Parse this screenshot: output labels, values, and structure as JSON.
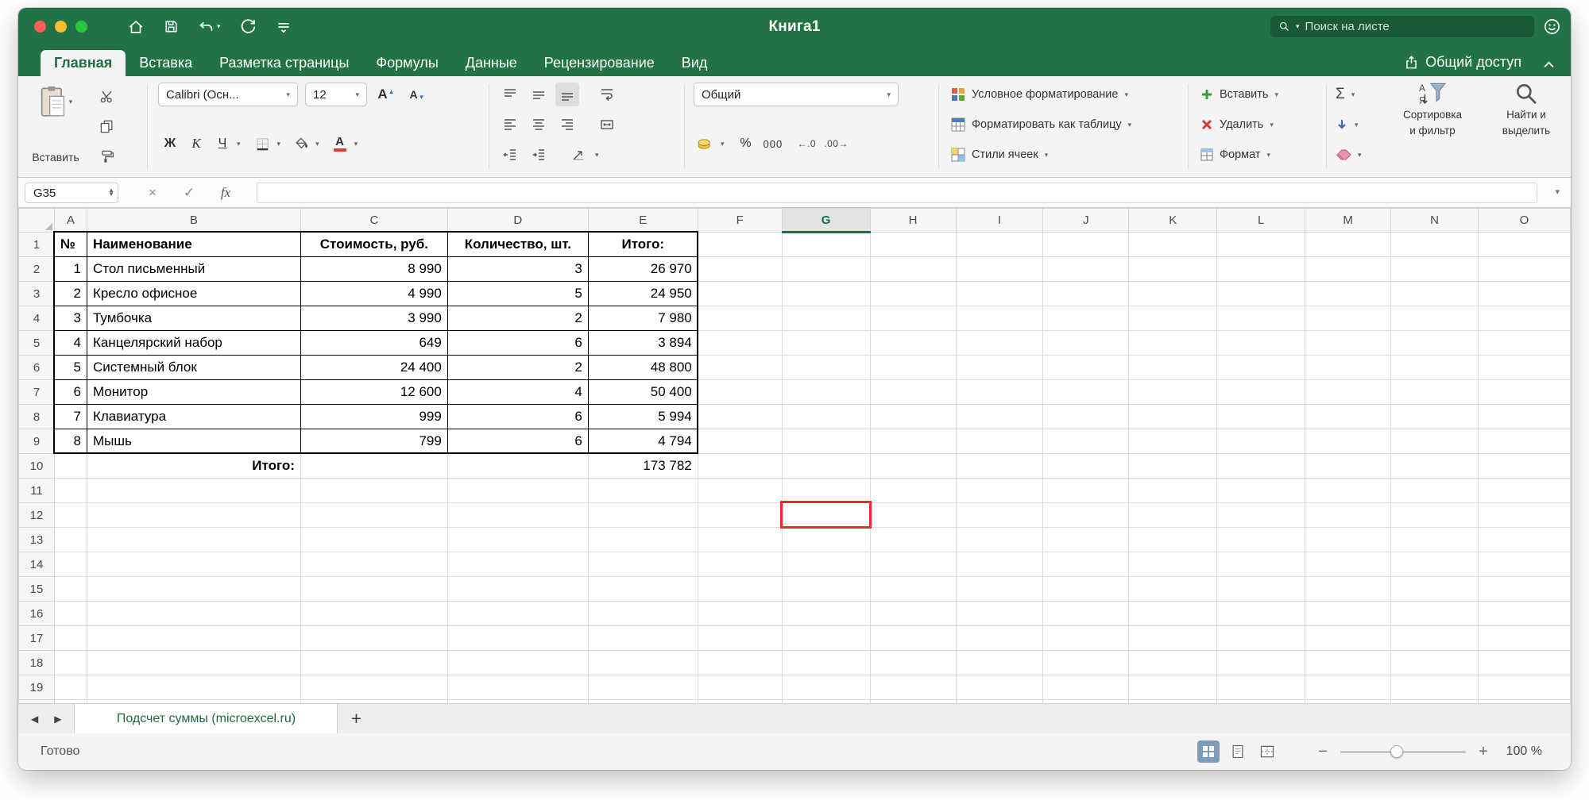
{
  "colors": {
    "brand_green": "#217346",
    "selection_red": "#ed2d24"
  },
  "title_bar": {
    "title": "Книга1",
    "search_placeholder": "Поиск на листе"
  },
  "ribbon_tabs": [
    {
      "label": "Главная",
      "active": true
    },
    {
      "label": "Вставка"
    },
    {
      "label": "Разметка страницы"
    },
    {
      "label": "Формулы"
    },
    {
      "label": "Данные"
    },
    {
      "label": "Рецензирование"
    },
    {
      "label": "Вид"
    }
  ],
  "share_label": "Общий доступ",
  "ribbon": {
    "paste_label": "Вставить",
    "font_name": "Calibri (Осн...",
    "font_size": "12",
    "grow_font": "A",
    "shrink_font": "A",
    "bold": "Ж",
    "italic": "К",
    "underline": "Ч",
    "font_color_letter": "А",
    "number_format": "Общий",
    "percent": "%",
    "thousands": "000",
    "increase_decimal": "←.0",
    "decrease_decimal": ".00→",
    "styles": [
      "Условное форматирование",
      "Форматировать как таблицу",
      "Стили ячеек"
    ],
    "cells": [
      "Вставить",
      "Удалить",
      "Формат"
    ],
    "autosum": "Σ",
    "sort_filter_line1": "Сортировка",
    "sort_filter_line2": "и фильтр",
    "find_select_line1": "Найти и",
    "find_select_line2": "выделить"
  },
  "formula_bar": {
    "name_box": "G35",
    "fx_label": "fx"
  },
  "grid": {
    "columns": [
      "A",
      "B",
      "C",
      "D",
      "E",
      "F",
      "G",
      "H",
      "I",
      "J",
      "K",
      "L",
      "M",
      "N",
      "O"
    ],
    "selected_column": "G",
    "row_count": 20,
    "red_cell": {
      "column": "G",
      "row": 12
    },
    "table": {
      "headers": [
        "№",
        "Наименование",
        "Стоимость, руб.",
        "Количество, шт.",
        "Итого:"
      ],
      "rows": [
        [
          "1",
          "Стол письменный",
          "8 990",
          "3",
          "26 970"
        ],
        [
          "2",
          "Кресло офисное",
          "4 990",
          "5",
          "24 950"
        ],
        [
          "3",
          "Тумбочка",
          "3 990",
          "2",
          "7 980"
        ],
        [
          "4",
          "Канцелярский набор",
          "649",
          "6",
          "3 894"
        ],
        [
          "5",
          "Системный блок",
          "24 400",
          "2",
          "48 800"
        ],
        [
          "6",
          "Монитор",
          "12 600",
          "4",
          "50 400"
        ],
        [
          "7",
          "Клавиатура",
          "999",
          "6",
          "5 994"
        ],
        [
          "8",
          "Мышь",
          "799",
          "6",
          "4 794"
        ]
      ],
      "total_label": "Итого:",
      "total_value": "173 782"
    }
  },
  "sheet_bar": {
    "tab_label": "Подсчет суммы (microexcel.ru)",
    "add_label": "+"
  },
  "status_bar": {
    "ready": "Готово",
    "zoom": "100 %"
  }
}
